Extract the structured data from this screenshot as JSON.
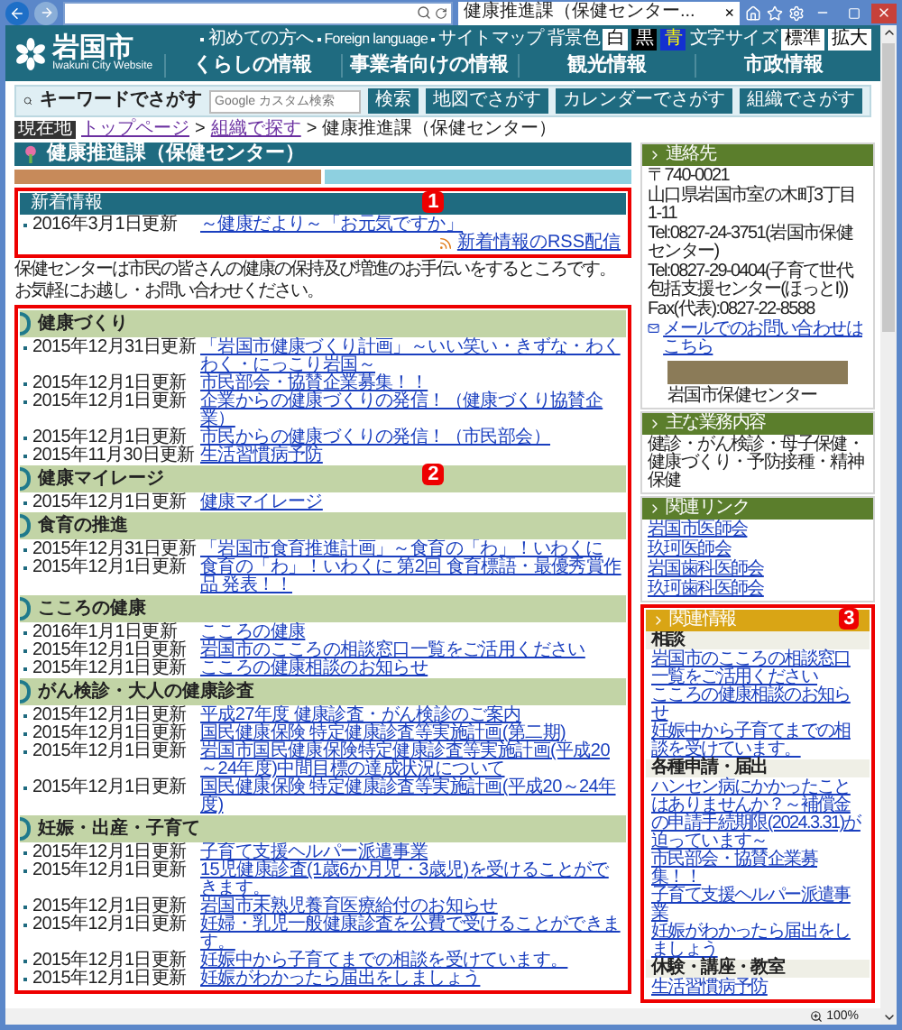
{
  "browser": {
    "tab_title": "健康推進課（保健センター...",
    "tab_close": "×",
    "zoom": "100%"
  },
  "header": {
    "logo": "岩国市",
    "logo_sub": "Iwakuni City Website",
    "links": [
      "初めての方へ",
      "Foreign language",
      "サイトマップ"
    ],
    "bg_label": "背景色",
    "bg_options": [
      {
        "label": "白",
        "kind": "white"
      },
      {
        "label": "黒",
        "kind": "black"
      },
      {
        "label": "青",
        "kind": "blue"
      }
    ],
    "size_label": "文字サイズ",
    "size_options": [
      "標準",
      "拡大"
    ],
    "nav": [
      "くらしの情報",
      "事業者向けの情報",
      "観光情報",
      "市政情報"
    ]
  },
  "search": {
    "label": "キーワードでさがす",
    "placeholder": "Google カスタム検索",
    "button": "検索",
    "links": [
      "地図でさがす",
      "カレンダーでさがす",
      "組織でさがす"
    ]
  },
  "breadcrumb": {
    "label": "現在地",
    "separator": ">",
    "items": [
      {
        "text": "トップページ",
        "kind": "link"
      },
      {
        "text": "組織で探す",
        "kind": "link"
      },
      {
        "text": "健康推進課（保健センター）",
        "kind": "current"
      }
    ]
  },
  "page_title": "健康推進課（保健センター）",
  "news": {
    "marker": "1",
    "title": "新着情報",
    "items": [
      {
        "date": "2016年3月1日更新",
        "link": "～健康だより～「お元気ですか」"
      }
    ],
    "rss": "新着情報のRSS配信"
  },
  "intro": [
    "保健センターは市民の皆さんの健康の保持及び増進のお手伝いをするところです。",
    "お気軽にお越し・お問い合わせください。"
  ],
  "sections_marker": "2",
  "sections": [
    {
      "title": "健康づくり",
      "items": [
        {
          "date": "2015年12月31日更新",
          "link": "「岩国市健康づくり計画」～いい笑い・きずな・わくわく・にっこり岩国～"
        },
        {
          "date": "2015年12月1日更新",
          "link": "市民部会・協賛企業募集！！"
        },
        {
          "date": "2015年12月1日更新",
          "link": "企業からの健康づくりの発信！（健康づくり協賛企業）"
        },
        {
          "date": "2015年12月1日更新",
          "link": "市民からの健康づくりの発信！（市民部会）"
        },
        {
          "date": "2015年11月30日更新",
          "link": "生活習慣病予防"
        }
      ]
    },
    {
      "title": "健康マイレージ",
      "items": [
        {
          "date": "2015年12月1日更新",
          "link": "健康マイレージ"
        }
      ]
    },
    {
      "title": "食育の推進",
      "items": [
        {
          "date": "2015年12月31日更新",
          "link": "「岩国市食育推進計画」～食育の「わ」！いわくに"
        },
        {
          "date": "2015年12月1日更新",
          "link": "食育の「わ」！いわくに 第2回 食育標語・最優秀賞作品 発表！！"
        }
      ]
    },
    {
      "title": "こころの健康",
      "items": [
        {
          "date": "2016年1月1日更新",
          "link": "こころの健康"
        },
        {
          "date": "2015年12月1日更新",
          "link": "岩国市のこころの相談窓口一覧をご活用ください"
        },
        {
          "date": "2015年12月1日更新",
          "link": "こころの健康相談のお知らせ"
        }
      ]
    },
    {
      "title": "がん検診・大人の健康診査",
      "items": [
        {
          "date": "2015年12月1日更新",
          "link": "平成27年度 健康診査・がん検診のご案内"
        },
        {
          "date": "2015年12月1日更新",
          "link": "国民健康保険 特定健康診査等実施計画(第二期)"
        },
        {
          "date": "2015年12月1日更新",
          "link": "岩国市国民健康保険特定健康診査等実施計画(平成20～24年度)中間目標の達成状況について"
        },
        {
          "date": "2015年12月1日更新",
          "link": "国民健康保険 特定健康診査等実施計画(平成20～24年度)"
        }
      ]
    },
    {
      "title": "妊娠・出産・子育て",
      "items": [
        {
          "date": "2015年12月1日更新",
          "link": "子育て支援ヘルパー派遣事業"
        },
        {
          "date": "2015年12月1日更新",
          "link": "15児健康診査(1歳6か月児・3歳児)を受けることができます。"
        },
        {
          "date": "2015年12月1日更新",
          "link": "岩国市未熟児養育医療給付のお知らせ"
        },
        {
          "date": "2015年12月1日更新",
          "link": "妊婦・乳児一般健康診査を公費で受けることができます。"
        },
        {
          "date": "2015年12月1日更新",
          "link": "妊娠中から子育てまでの相談を受けています。"
        },
        {
          "date": "2015年12月1日更新",
          "link": "妊娠がわかったら届出をしましょう"
        }
      ]
    }
  ],
  "sidebar": {
    "contact": {
      "title": "連絡先",
      "lines": [
        "〒740-0021",
        "山口県岩国市室の木町3丁目1-11",
        "Tel:0827-24-3751(岩国市保健センター)",
        "Tel:0827-29-0404(子育て世代包括支援センター(ほっとI))",
        "Fax(代表):0827-22-8588"
      ],
      "mail_link": "メールでのお問い合わせはこちら",
      "photo_caption": "岩国市保健センター"
    },
    "business": {
      "title": "主な業務内容",
      "text": "健診・がん検診・母子保健・健康づくり・予防接種・精神保健"
    },
    "links": {
      "title": "関連リンク",
      "items": [
        "岩国市医師会",
        "玖珂医師会",
        "岩国歯科医師会",
        "玖珂歯科医師会"
      ]
    },
    "related": {
      "marker": "3",
      "title": "関連情報",
      "groups": [
        {
          "title": "相談",
          "items": [
            "岩国市のこころの相談窓口一覧をご活用ください",
            "こころの健康相談のお知らせ",
            "妊娠中から子育てまでの相談を受けています。"
          ]
        },
        {
          "title": "各種申請・届出",
          "items": [
            "ハンセン病にかかったことはありませんか？～補償金の申請手続期限(2024.3.31)が迫っています～",
            "市民部会・協賛企業募集！！",
            "子育て支援ヘルパー派遣事業",
            "妊娠がわかったら届出をしましょう"
          ]
        },
        {
          "title": "休験・講座・教室",
          "items": [
            "生活習慣病予防"
          ]
        }
      ]
    }
  }
}
